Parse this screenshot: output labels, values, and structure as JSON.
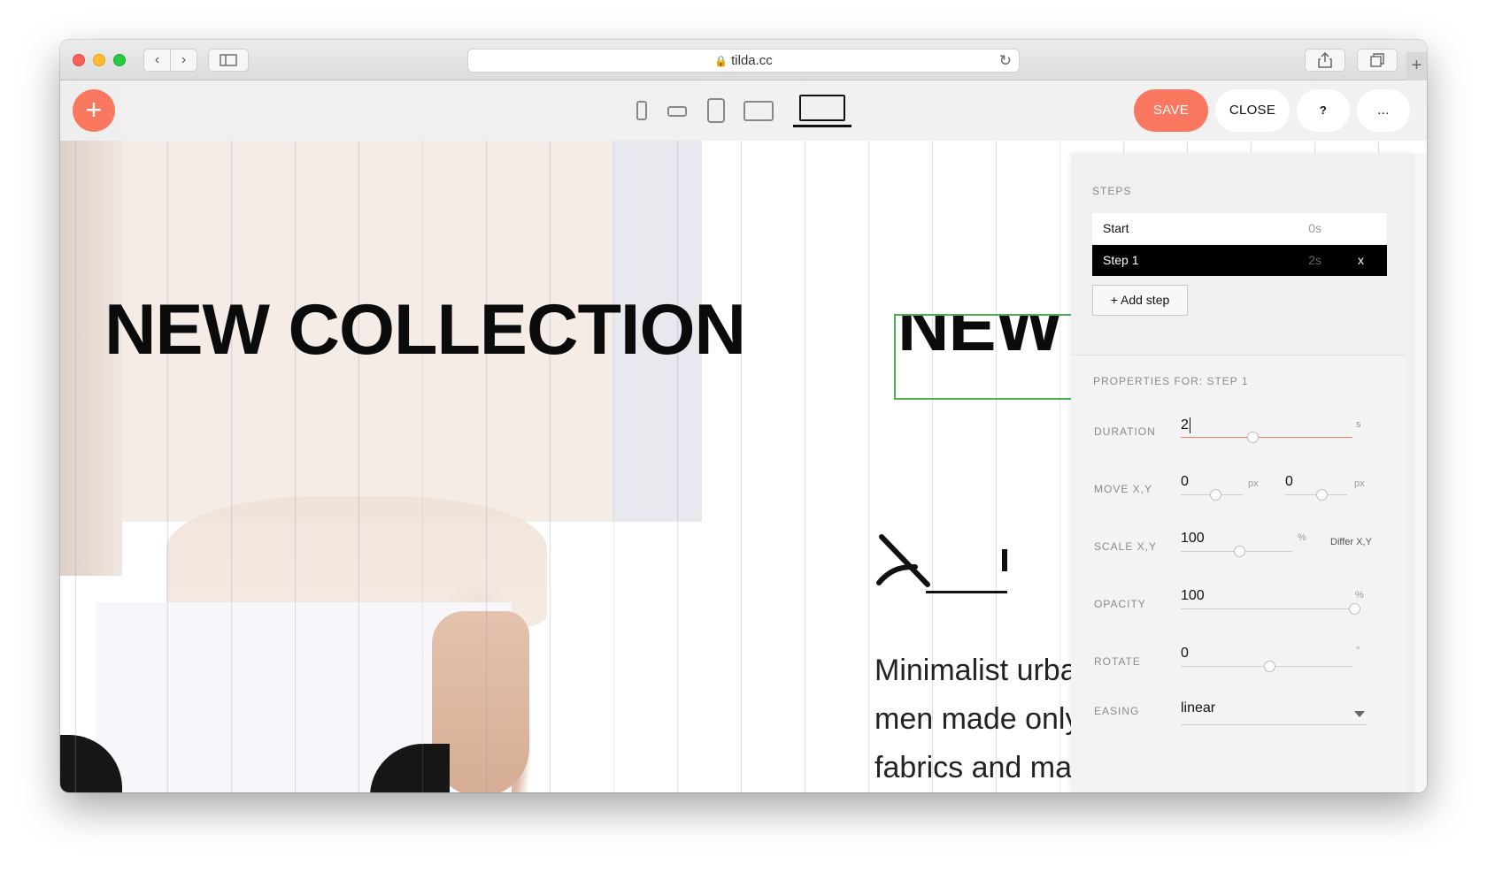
{
  "browser": {
    "url": "tilda.cc",
    "nav_back": "‹",
    "nav_forward": "›",
    "reload": "↻",
    "newtab": "+"
  },
  "toolbar": {
    "add_label": "+",
    "save_label": "SAVE",
    "close_label": "CLOSE",
    "help_label": "?",
    "more_label": "...",
    "active_device": "desktop"
  },
  "canvas": {
    "headline": "NEW COLLECTION",
    "headline_selected": "NEW COLLECTION",
    "body_text_line1": "Minimalist urban",
    "body_text_line2": "men made only",
    "body_text_line3": "fabrics and materials"
  },
  "panel": {
    "steps_label": "STEPS",
    "steps": [
      {
        "name": "Start",
        "duration": "0s"
      },
      {
        "name": "Step 1",
        "duration": "2s",
        "remove": "x"
      }
    ],
    "add_step_label": "+ Add step",
    "properties_title": "PROPERTIES FOR: STEP 1",
    "duration": {
      "label": "DURATION",
      "value": "2",
      "unit": "s"
    },
    "move": {
      "label": "MOVE X,Y",
      "x": "0",
      "y": "0",
      "unit": "px"
    },
    "scale": {
      "label": "SCALE X,Y",
      "value": "100",
      "unit": "%",
      "differ": "Differ X,Y"
    },
    "opacity": {
      "label": "OPACITY",
      "value": "100",
      "unit": "%"
    },
    "rotate": {
      "label": "ROTATE",
      "value": "0",
      "unit": "°"
    },
    "easing": {
      "label": "EASING",
      "value": "linear"
    }
  },
  "colors": {
    "accent": "#fa7860",
    "selection": "#4caf50",
    "dark": "#000000"
  }
}
